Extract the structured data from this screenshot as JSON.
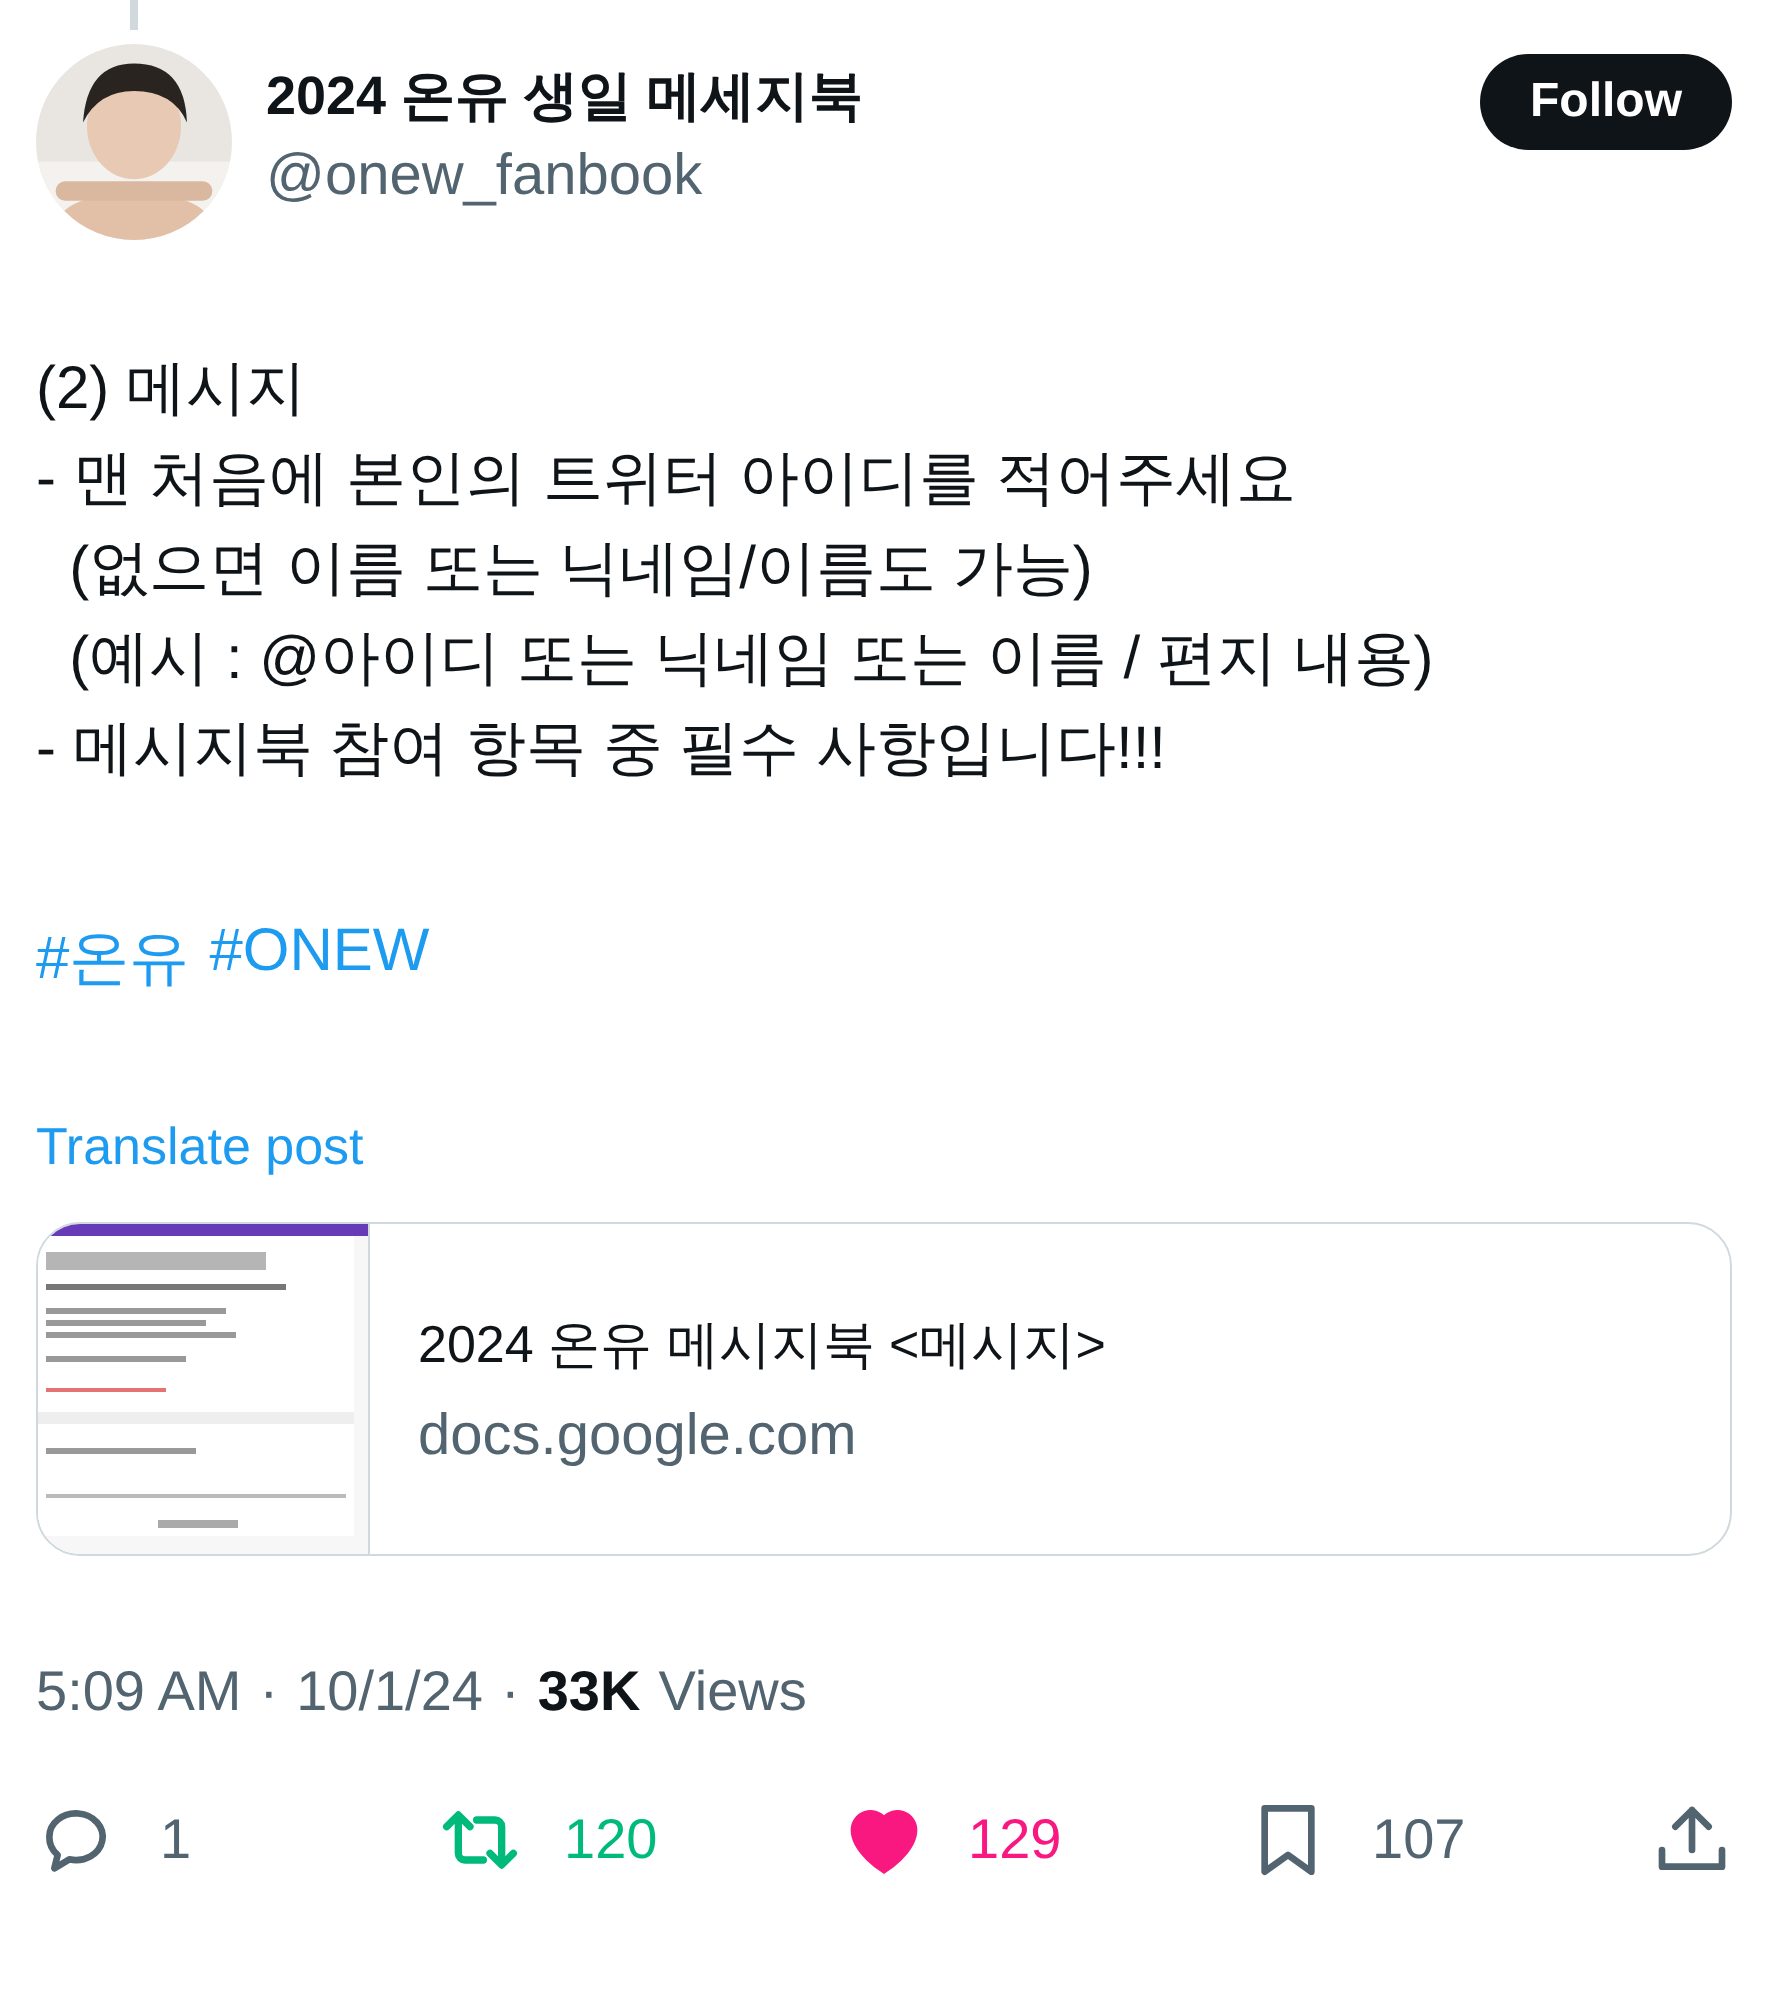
{
  "author": {
    "name": "2024 온유 생일 메세지북",
    "handle": "@onew_fanbook",
    "follow_label": "Follow"
  },
  "body": {
    "lines": [
      "(2) 메시지",
      "- 맨 처음에 본인의 트위터 아이디를 적어주세요",
      "  (없으면 이름 또는 닉네임/이름도 가능)",
      "  (예시 : @아이디 또는 닉네임 또는 이름 / 편지 내용)",
      "- 메시지북 참여 항목 중 필수 사항입니다!!!"
    ],
    "hashtags": [
      "#온유",
      "#ONEW"
    ]
  },
  "translate_label": "Translate post",
  "link_card": {
    "title": "2024 온유 메시지북 <메시지>",
    "domain": "docs.google.com"
  },
  "meta": {
    "time": "5:09 AM",
    "separator_1": "·",
    "date": "10/1/24",
    "separator_2": "·",
    "views_count": "33K",
    "views_label": "Views"
  },
  "actions": [
    {
      "kind": "reply",
      "count": "1",
      "active": false
    },
    {
      "kind": "repost",
      "count": "120",
      "active": true
    },
    {
      "kind": "like",
      "count": "129",
      "active": true
    },
    {
      "kind": "bookmark",
      "count": "107",
      "active": false
    },
    {
      "kind": "share",
      "active": false
    }
  ]
}
